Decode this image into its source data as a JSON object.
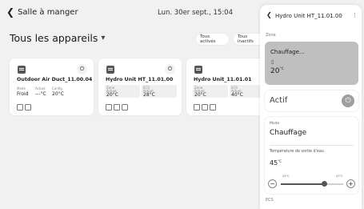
{
  "topbar": {
    "back_label": "Salle à manger",
    "datetime": "Lun. 30er sept., 15:04"
  },
  "page_title": "Tous les appareils",
  "filters": [
    "Tous activés",
    "Tous inactifs"
  ],
  "cards": [
    {
      "name": "Outdoor Air Duct_11.00.04",
      "power_glyph": "⏻",
      "mode_label": "Mode",
      "mode_value": "Froid",
      "actual_label": "Actuel",
      "actual_value": "---°C",
      "config_label": "Config",
      "config_value": "20°C"
    },
    {
      "name": "Hydro Unit HT_11.01.00",
      "power_glyph": "⏻",
      "zone_label": "Zone",
      "zone_sub": "Actuel",
      "zone_value": "20°C",
      "ecs_label": "ECS",
      "ecs_sub": "Actuel",
      "ecs_value": "28°C"
    },
    {
      "name": "Hydro Unit_11.01.01",
      "zone_label": "Zone",
      "zone_sub": "Actuel",
      "zone_value": "20°C",
      "ecs_label": "ECS",
      "ecs_sub": "Actuel",
      "ecs_value": "40°C"
    }
  ],
  "panel": {
    "title": "Hydro Unit HT_11.01.00",
    "zone_section": "Zone",
    "zone_status": "Chauffage...",
    "zone_temp": "20",
    "zone_temp_unit": "°C",
    "actif_label": "Actif",
    "mode_label": "Mode",
    "mode_value": "Chauffage",
    "water_label": "Température de sortie d'eau",
    "water_temp": "45",
    "water_temp_unit": "°C",
    "min_label": "25°C",
    "max_label": "47°C",
    "slider_fraction": 0.7,
    "ecs_section": "ECS"
  }
}
